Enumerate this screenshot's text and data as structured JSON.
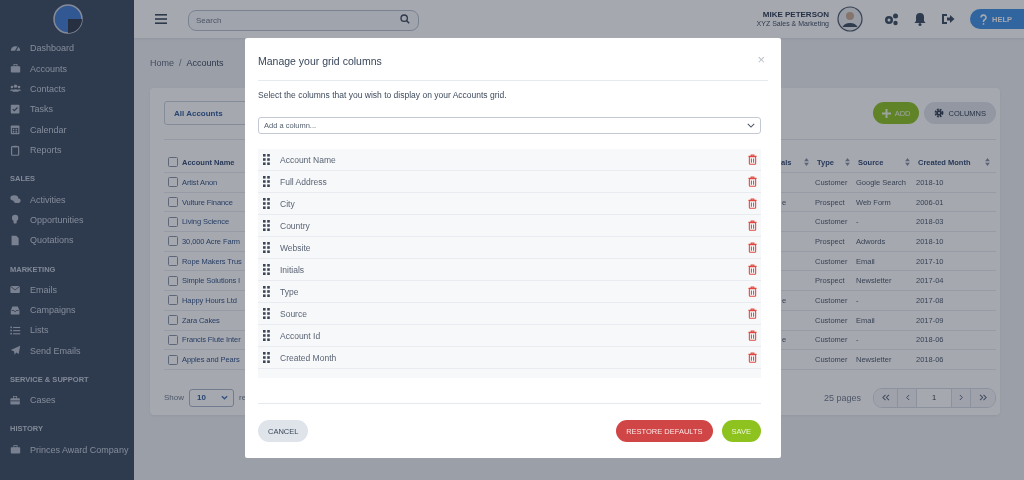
{
  "sidebar": {
    "groups": [
      {
        "items": [
          "Dashboard",
          "Accounts",
          "Contacts",
          "Tasks",
          "Calendar",
          "Reports"
        ]
      },
      {
        "heading": "SALES",
        "items": [
          "Activities",
          "Opportunities",
          "Quotations"
        ]
      },
      {
        "heading": "MARKETING",
        "items": [
          "Emails",
          "Campaigns",
          "Lists",
          "Send Emails"
        ]
      },
      {
        "heading": "SERVICE & SUPPORT",
        "items": [
          "Cases"
        ]
      },
      {
        "heading": "HISTORY",
        "items": [
          "Princes Award Company"
        ]
      }
    ]
  },
  "topbar": {
    "search": {
      "placeholder": "Search"
    },
    "user": {
      "name": "MIKE PETERSON",
      "role": "XYZ Sales & Marketing"
    },
    "help_button": "HELP"
  },
  "breadcrumb": {
    "items": [
      "Home",
      "Accounts"
    ],
    "separator": "/"
  },
  "accounts": {
    "view_select": "All Accounts",
    "add_button": "ADD",
    "columns_button": "COLUMNS",
    "header_checked": false,
    "name_column": "Account Name",
    "right_columns": [
      "als",
      "Type",
      "Source",
      "Created Month"
    ],
    "rows": [
      {
        "checked": false,
        "name": "Artist Anon",
        "type": "Customer",
        "source": "Google Search",
        "created": "2018-10"
      },
      {
        "checked": false,
        "name": "Vulture Finance",
        "initials": "e",
        "type": "Prospect",
        "source": "Web Form",
        "created": "2006-01"
      },
      {
        "checked": false,
        "name": "Living Science",
        "type": "Customer",
        "source": "-",
        "created": "2018-03"
      },
      {
        "checked": false,
        "name": "30,000 Acre Farm",
        "type": "Prospect",
        "source": "Adwords",
        "created": "2018-10"
      },
      {
        "checked": false,
        "name": "Rope Makers Trus",
        "type": "Customer",
        "source": "Email",
        "created": "2017-10"
      },
      {
        "checked": false,
        "name": "Simple Solutions l",
        "type": "Prospect",
        "source": "Newsletter",
        "created": "2017-04"
      },
      {
        "checked": false,
        "name": "Happy Hours Ltd",
        "initials": "e",
        "type": "Customer",
        "source": "-",
        "created": "2017-08"
      },
      {
        "checked": false,
        "name": "Zara Cakes",
        "type": "Customer",
        "source": "Email",
        "created": "2017-09"
      },
      {
        "checked": false,
        "name": "Francis Flute Inter",
        "initials": "e",
        "type": "Customer",
        "source": "-",
        "created": "2018-06"
      },
      {
        "checked": false,
        "name": "Apples and Pears",
        "type": "Customer",
        "source": "Newsletter",
        "created": "2018-06"
      }
    ],
    "footer": {
      "show_label": "Show",
      "page_size": "10",
      "records_label": "re",
      "pages": "25 pages",
      "page": "1"
    }
  },
  "modal": {
    "title": "Manage your grid columns",
    "close": "×",
    "description": "Select the columns that you wish to display on your Accounts grid.",
    "add_select": {
      "placeholder": "Add a column..."
    },
    "columns": [
      "Account Name",
      "Full Address",
      "City",
      "Country",
      "Website",
      "Initials",
      "Type",
      "Source",
      "Account Id",
      "Created Month"
    ],
    "buttons": {
      "cancel": "CANCEL",
      "restore": "RESTORE DEFAULTS",
      "save": "SAVE"
    }
  }
}
